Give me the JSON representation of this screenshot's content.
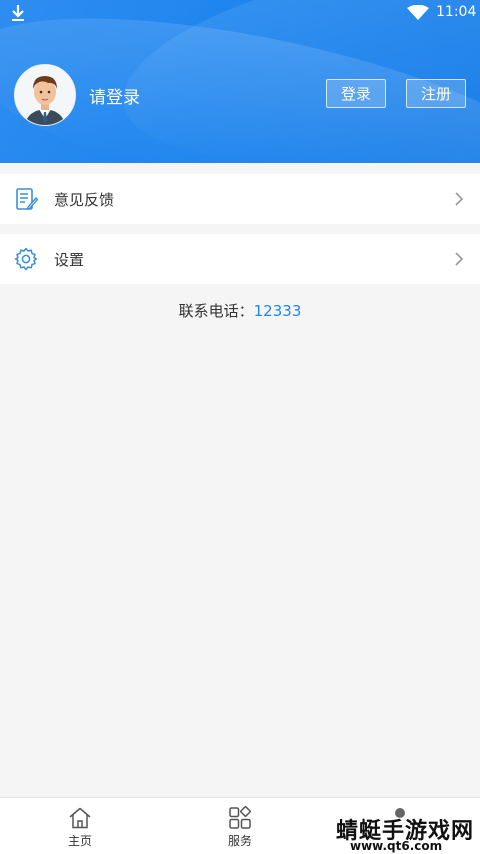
{
  "status_bar": {
    "time": "11:04",
    "icons": [
      "download-icon",
      "wifi-icon"
    ]
  },
  "profile": {
    "login_prompt": "请登录",
    "login_button": "登录",
    "register_button": "注册",
    "avatar_icon": "avatar-icon"
  },
  "menu": [
    {
      "label": "意见反馈",
      "icon": "feedback-icon"
    },
    {
      "label": "设置",
      "icon": "settings-icon"
    }
  ],
  "contact": {
    "label": "联系电话：",
    "phone": "12333"
  },
  "tabbar": {
    "items": [
      {
        "label": "主页",
        "icon": "home-icon"
      },
      {
        "label": "服务",
        "icon": "services-icon"
      },
      {
        "label": "",
        "icon": "profile-dot-icon"
      }
    ]
  },
  "watermark": {
    "text": "蜻蜓手游戏网",
    "url": "www.qt6.com"
  },
  "colors": {
    "header_blue": "#1f86ef",
    "accent_blue": "#1f86ef",
    "icon_blue": "#3b8fd6",
    "background": "#f5f5f5"
  }
}
